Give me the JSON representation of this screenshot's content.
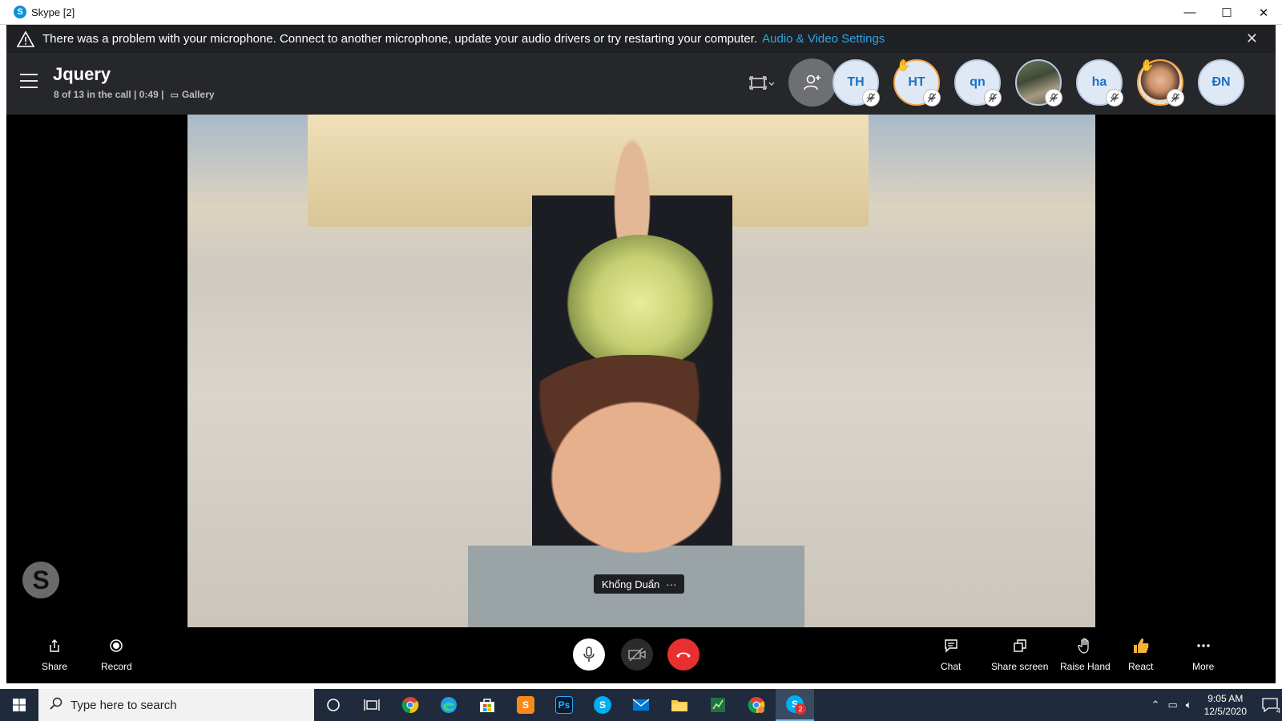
{
  "window": {
    "title": "Skype [2]",
    "app_icon_letter": "S",
    "minimize": "—",
    "maximize": "☐",
    "close": "✕"
  },
  "banner": {
    "message": "There was a problem with your microphone. Connect to another microphone, update your audio drivers or try restarting your computer.",
    "link": "Audio & Video Settings",
    "close_icon": "✕"
  },
  "call": {
    "title": "Jquery",
    "status": "8 of 13 in the call | 0:49 |",
    "view_mode": "Gallery",
    "participants": [
      {
        "initials": "TH",
        "muted": true,
        "hand_raised": false
      },
      {
        "initials": "HT",
        "muted": true,
        "hand_raised": true
      },
      {
        "initials": "qn",
        "muted": true,
        "hand_raised": false
      },
      {
        "initials": "",
        "muted": true,
        "hand_raised": false,
        "photo": true
      },
      {
        "initials": "ha",
        "muted": true,
        "hand_raised": false
      },
      {
        "initials": "",
        "muted": true,
        "hand_raised": true,
        "photo": true
      },
      {
        "initials": "ĐN",
        "muted": false,
        "hand_raised": false
      }
    ]
  },
  "video": {
    "speaker_name": "Khổng Duẩn",
    "speaker_menu": "···",
    "watermark": "S"
  },
  "controls": {
    "share": "Share",
    "record": "Record",
    "chat": "Chat",
    "share_screen": "Share screen",
    "raise_hand": "Raise Hand",
    "react": "React",
    "more": "More"
  },
  "taskbar": {
    "search_placeholder": "Type here to search",
    "time": "9:05 AM",
    "date": "12/5/2020",
    "notification_count": "4",
    "skype_badge": "2",
    "ps_label": "Ps"
  },
  "colors": {
    "accent_link": "#2ea6ec",
    "end_call": "#e83030",
    "header_bg": "#26272b",
    "taskbar_bg": "#1f2b3c"
  }
}
